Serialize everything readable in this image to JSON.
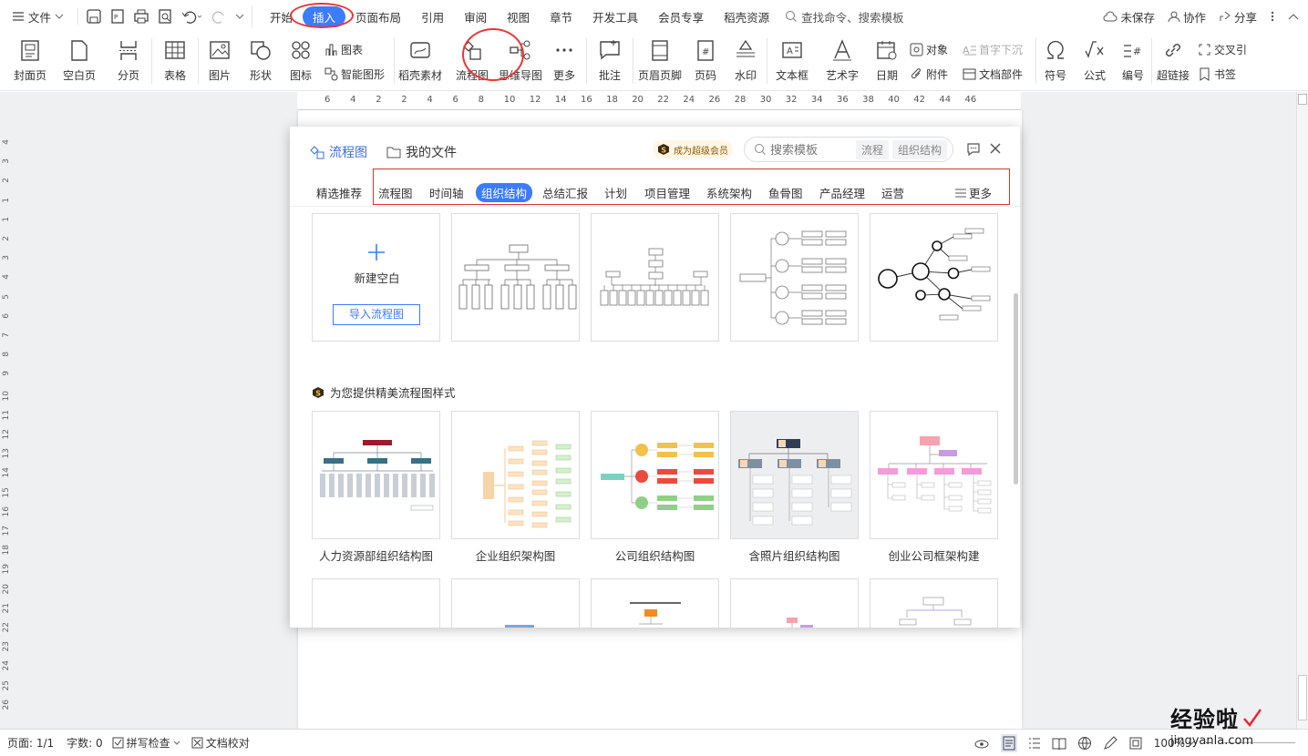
{
  "menubar": {
    "file": "文件",
    "tabs": [
      "开始",
      "插入",
      "页面布局",
      "引用",
      "审阅",
      "视图",
      "章节",
      "开发工具",
      "会员专享",
      "稻壳资源"
    ],
    "active_tab": "插入",
    "search_placeholder": "查找命令、搜索模板",
    "unsaved": "未保存",
    "collab": "协作",
    "share": "分享"
  },
  "ribbon": {
    "cover": "封面页",
    "blank": "空白页",
    "pagebreak": "分页",
    "table": "表格",
    "picture": "图片",
    "shape": "形状",
    "iconlib": "图标",
    "chart": "图表",
    "smartart": "智能图形",
    "daoke": "稻壳素材",
    "flowchart": "流程图",
    "mindmap": "思维导图",
    "more": "更多",
    "comment": "批注",
    "headerfooter": "页眉页脚",
    "pagenum": "页码",
    "watermark": "水印",
    "textbox": "文本框",
    "wordart": "艺术字",
    "date": "日期",
    "object": "对象",
    "attachment": "附件",
    "dropcap": "首字下沉",
    "docpart": "文档部件",
    "symbol": "符号",
    "formula": "公式",
    "numbering": "编号",
    "hyperlink": "超链接",
    "crossref": "交叉引",
    "bookmark": "书签"
  },
  "ruler": {
    "h_ticks": [
      "6",
      "4",
      "2",
      "2",
      "4",
      "6",
      "8",
      "10",
      "12",
      "14",
      "16",
      "18",
      "20",
      "22",
      "24",
      "26",
      "28",
      "30",
      "32",
      "34",
      "36",
      "38",
      "40",
      "42",
      "44",
      "46"
    ],
    "v_ticks": [
      "4",
      "3",
      "2",
      "1",
      "1",
      "2",
      "3",
      "4",
      "5",
      "6",
      "7",
      "8",
      "9",
      "10",
      "11",
      "12",
      "13",
      "14",
      "15",
      "16",
      "17",
      "18",
      "19",
      "20",
      "21",
      "22",
      "23",
      "24",
      "25",
      "26"
    ]
  },
  "dialog": {
    "tab_flowchart": "流程图",
    "tab_myfiles": "我的文件",
    "vip": "成为超级会员",
    "search_placeholder": "搜索模板",
    "chip1": "流程",
    "chip2": "组织结构",
    "categories": [
      "精选推荐",
      "流程图",
      "时间轴",
      "组织结构",
      "总结汇报",
      "计划",
      "项目管理",
      "系统架构",
      "鱼骨图",
      "产品经理",
      "运营"
    ],
    "selected_category": "组织结构",
    "more": "更多",
    "new_blank": "新建空白",
    "import": "导入流程图",
    "premium_section": "为您提供精美流程图样式",
    "premium_cards": [
      "人力资源部组织结构图",
      "企业组织架构图",
      "公司组织结构图",
      "含照片组织结构图",
      "创业公司框架构建"
    ],
    "colors": {
      "accent": "#3d7bff",
      "highlight": "#dd3333"
    }
  },
  "statusbar": {
    "page": "页面: 1/1",
    "words": "字数: 0",
    "spell": "拼写检查",
    "proof": "文档校对",
    "zoom": "100%"
  },
  "watermark": {
    "brand": "经验啦",
    "url": "jingyanla.com"
  }
}
